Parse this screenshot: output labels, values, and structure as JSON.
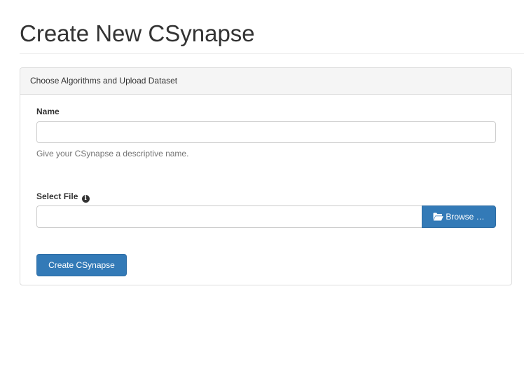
{
  "page": {
    "title": "Create New CSynapse"
  },
  "panel": {
    "heading": "Choose Algorithms and Upload Dataset",
    "name_field": {
      "label": "Name",
      "value": "",
      "placeholder": "",
      "help": "Give your CSynapse a descriptive name."
    },
    "file_field": {
      "label": "Select File",
      "info_icon": "info-circle-icon",
      "value": "",
      "browse_label": "Browse …",
      "browse_icon": "folder-open-icon"
    },
    "submit_label": "Create CSynapse"
  },
  "colors": {
    "primary": "#337ab7",
    "primary_border": "#2e6da4",
    "panel_heading_bg": "#f5f5f5",
    "border": "#dddddd",
    "help_text": "#737373"
  }
}
